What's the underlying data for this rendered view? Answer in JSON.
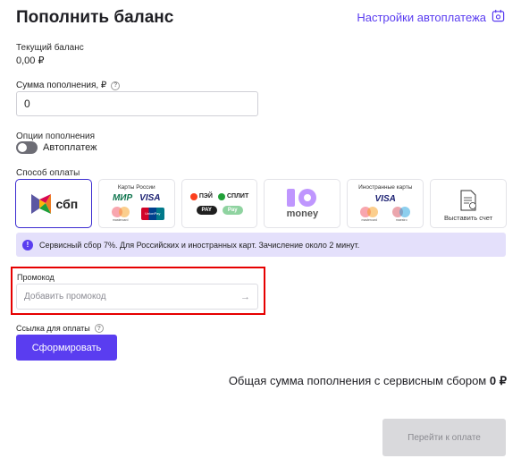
{
  "header": {
    "title": "Пополнить баланс",
    "autopay_settings_link": "Настройки автоплатежа"
  },
  "balance": {
    "label": "Текущий баланс",
    "value": "0,00 ₽"
  },
  "amount": {
    "label": "Сумма пополнения, ₽",
    "value": "0"
  },
  "options": {
    "label": "Опции пополнения",
    "autopay_label": "Автоплатеж",
    "autopay_enabled": false
  },
  "payment": {
    "label": "Способ оплаты",
    "methods": [
      {
        "id": "sbp",
        "title": "сбп",
        "selected": true
      },
      {
        "id": "russian-cards",
        "caption": "Карты России",
        "brands": [
          "МИР",
          "VISA",
          "mastercard",
          "UnionPay"
        ]
      },
      {
        "id": "wallets",
        "brands": [
          "ПЭЙ",
          "СПЛИТ",
          "PAY",
          "Pay"
        ]
      },
      {
        "id": "yoomoney",
        "title": "money"
      },
      {
        "id": "foreign-cards",
        "caption": "Иностранные карты",
        "brands": [
          "VISA",
          "mastercard",
          "maestro"
        ]
      },
      {
        "id": "invoice",
        "caption": "Выставить счет"
      }
    ]
  },
  "notice": {
    "text": "Сервисный сбор 7%. Для Российских и иностранных карт. Зачисление около 2 минут."
  },
  "promo": {
    "label": "Промокод",
    "placeholder": "Добавить промокод",
    "arrow": "→"
  },
  "payment_link": {
    "label": "Ссылка для оплаты",
    "button_label": "Сформировать"
  },
  "total": {
    "label": "Общая сумма пополнения с сервисным сбором",
    "value": "0 ₽"
  },
  "pay_button_label": "Перейти к оплате",
  "colors": {
    "accent": "#5a3df0",
    "highlight": "#e60000",
    "notice_bg": "#e4e0fb"
  }
}
